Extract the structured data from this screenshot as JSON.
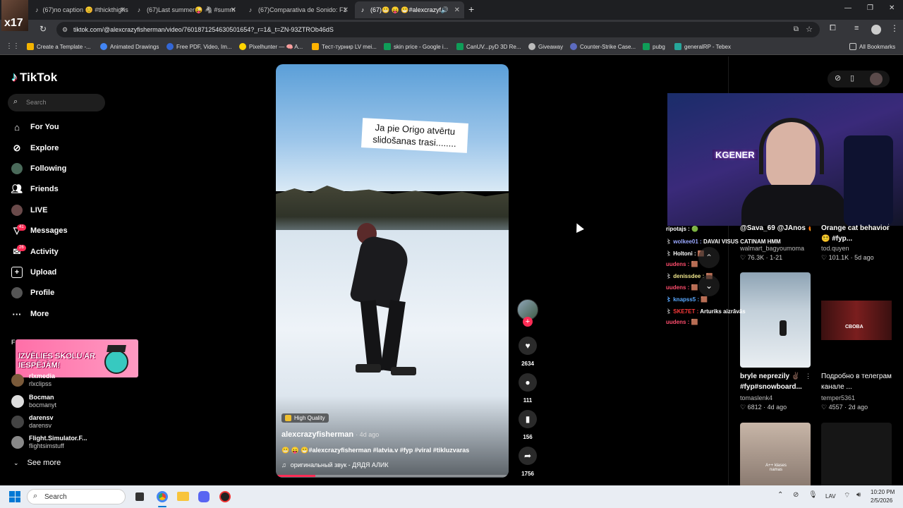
{
  "browser": {
    "tabs": [
      {
        "label": "(67)no caption 😊 #thickthighs"
      },
      {
        "label": "(67)Last summer😜 🦓 #summ"
      },
      {
        "label": "(67)Comparativa de Sonido: F1"
      },
      {
        "label": "(67)😬 😛 😁#alexcrazyfish"
      }
    ],
    "new_tab": "+",
    "url": "tiktok.com/@alexcrazyfisherman/video/7601871254630501654?_r=1&_t=ZN-93ZTROb46dS",
    "bookmarks": [
      {
        "label": "Create a Template -...",
        "color": "#f4b400"
      },
      {
        "label": "Animated Drawings",
        "color": "#4285f4"
      },
      {
        "label": "Free PDF, Video, Im...",
        "color": "#3367d6"
      },
      {
        "label": "Pixelhunter — 🧠 A...",
        "color": "#ffd400"
      },
      {
        "label": "Тест-турнир LV mei...",
        "color": "#ffb300"
      },
      {
        "label": "skin price - Google i...",
        "color": "#0f9d58"
      },
      {
        "label": "CanUV...pyD 3D Re...",
        "color": "#0f9d58"
      },
      {
        "label": "Giveaway",
        "color": "#bbbbbb"
      },
      {
        "label": "Counter-Strike Case...",
        "color": "#5c6bc0"
      },
      {
        "label": "pubg",
        "color": "#0f9d58"
      },
      {
        "label": "generalRP - Tebex",
        "color": "#26a69a"
      }
    ],
    "all_bookmarks": "All Bookmarks"
  },
  "sidebar": {
    "logo": "TikTok",
    "search_placeholder": "Search",
    "nav": [
      {
        "label": "For You",
        "icon": "home-icon"
      },
      {
        "label": "Explore",
        "icon": "compass-icon"
      },
      {
        "label": "Following",
        "icon": "avatar-icon"
      },
      {
        "label": "Friends",
        "icon": "friends-icon"
      },
      {
        "label": "LIVE",
        "icon": "live-icon"
      },
      {
        "label": "Messages",
        "icon": "messages-icon",
        "badge": "41"
      },
      {
        "label": "Activity",
        "icon": "activity-icon",
        "badge": "26"
      },
      {
        "label": "Upload",
        "icon": "upload-icon"
      },
      {
        "label": "Profile",
        "icon": "profile-icon"
      },
      {
        "label": "More",
        "icon": "more-icon"
      }
    ],
    "section_letter": "F",
    "banner": "IZVĒLIES SKOLU AR IESPĒJĀM!",
    "accounts": [
      {
        "name": "rlxmedia",
        "handle": "rlxclipss"
      },
      {
        "name": "Bocman",
        "handle": "bocmanyt"
      },
      {
        "name": "darensv",
        "handle": "darensv"
      },
      {
        "name": "Flight.Simulator.F...",
        "handle": "flightsimstuff"
      }
    ],
    "see_more": "See more"
  },
  "video": {
    "caption_overlay": "Ja pie Origo atvērtu slidošanas trasi........",
    "quality": "High Quality",
    "author": "alexcrazyfisherman",
    "age": "· 4d ago",
    "description": "😬 😛 😁#alexcrazyfisherman #latvia.v #fyp #viral #tikluzvaras",
    "music": "оригинальный звук - ДЯДЯ АЛИК",
    "progress": 0.17
  },
  "actions": {
    "likes": "2634",
    "comments": "111",
    "saves": "156",
    "shares": "1756"
  },
  "chat": [
    {
      "user": "ripotajs :",
      "msg": "🟢",
      "color": "#ffffff"
    },
    {
      "user": "wolkee01 :",
      "msg": "DAVAI VISUS CATINAM HMM",
      "color": "#7b8cff"
    },
    {
      "user": "Holtoni :",
      "msg": "🟫",
      "color": "#ffffff"
    },
    {
      "user": "uudens :",
      "msg": "🟫",
      "color": "#ff4d6d"
    },
    {
      "user": "denissdee :",
      "msg": "🟫",
      "color": "#f0e68c"
    },
    {
      "user": "uudens :",
      "msg": "🟫",
      "color": "#ff4d6d"
    },
    {
      "user": "knapss5 :",
      "msg": "🟫",
      "color": "#5aa9ff"
    },
    {
      "user": "SKE7ET :",
      "msg": "Arturiks aizrāvās",
      "color": "#ff3b3b"
    },
    {
      "user": "uudens :",
      "msg": "🟫",
      "color": "#ff4d6d"
    }
  ],
  "grid": [
    {
      "title": "@Sava_69 @JAnos 🔥",
      "user": "walmart_bagyoumoma",
      "stat": "76.3K · 1-21"
    },
    {
      "title": "Orange cat behavior😵‍💫 #fyp...",
      "user": "tod.quyen",
      "stat": "101.1K · 5d ago"
    },
    {
      "title": "bryle neprezily ✌🏿 #fyp#snowboard...",
      "user": "tomaslenk4",
      "stat": "6812 · 4d ago"
    },
    {
      "title": "Подробно в телеграм канале ...",
      "user": "temper5361",
      "stat": "4557 · 2d ago"
    }
  ],
  "grid_thumb_text": {
    "cboba": "CBOBA",
    "kivi": "A++ klases namas"
  },
  "stream_label": "KGENER",
  "taskbar": {
    "search": "Search",
    "lang": "LAV",
    "time": "10:20 PM",
    "date": "2/5/2026"
  }
}
